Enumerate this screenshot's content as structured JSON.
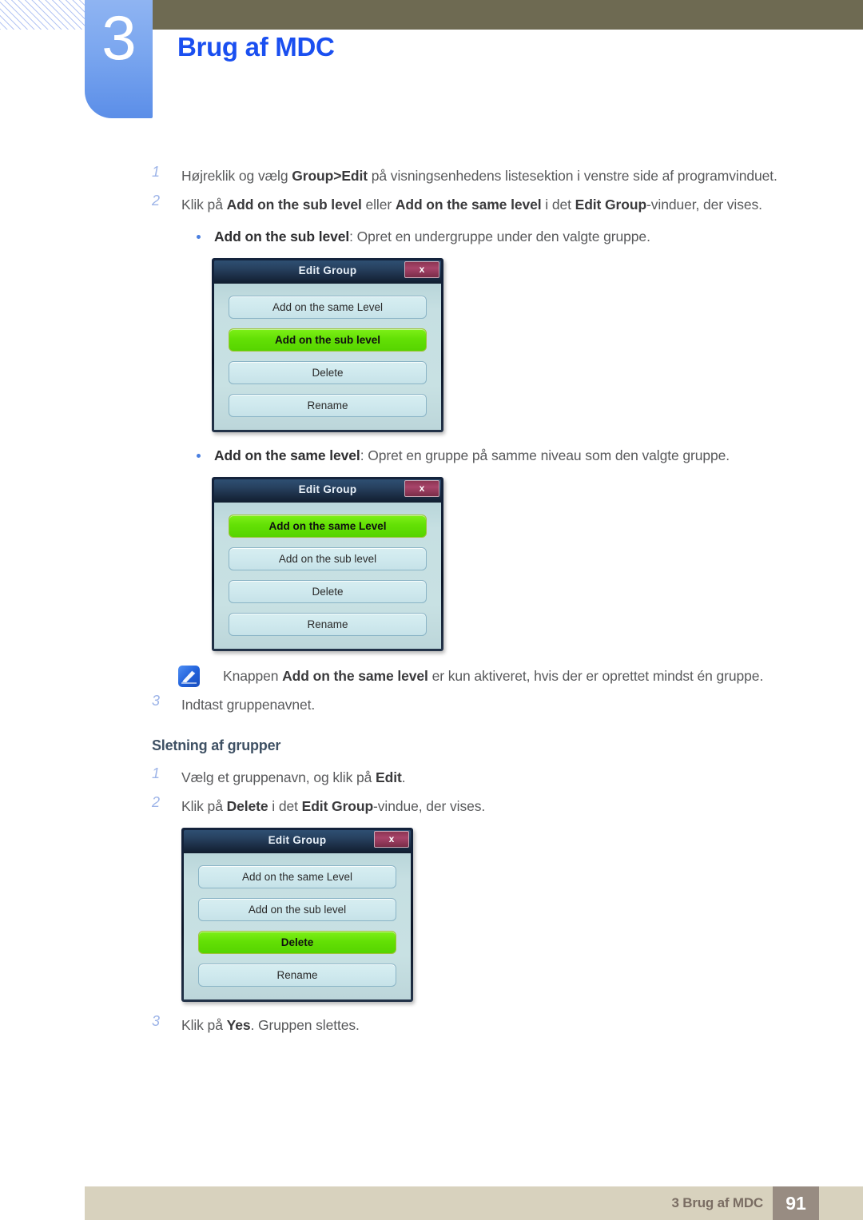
{
  "header": {
    "chapter_number": "3",
    "chapter_title": "Brug af MDC",
    "accent_color": "#1a4ff0",
    "tab_color": "#7aa6ef",
    "bar_color": "#6e6a52"
  },
  "steps": {
    "s1_num": "1",
    "s1_a": "Højreklik og vælg ",
    "s1_b": "Group>Edit",
    "s1_c": " på visningsenhedens listesektion i venstre side af programvinduet.",
    "s2_num": "2",
    "s2_a": "Klik på ",
    "s2_b": "Add on the sub level",
    "s2_c": " eller ",
    "s2_d": "Add on the same level",
    "s2_e": " i det ",
    "s2_f": "Edit Group",
    "s2_g": "-vinduer, der vises.",
    "b1_b": "Add on the sub level",
    "b1_c": ": Opret en undergruppe under den valgte gruppe.",
    "b2_b": "Add on the same level",
    "b2_c": ": Opret en gruppe på samme niveau som den valgte gruppe.",
    "note_a": "Knappen ",
    "note_b": "Add on the same level",
    "note_c": " er kun aktiveret, hvis der er oprettet mindst én gruppe.",
    "s3_num": "3",
    "s3_a": "Indtast gruppenavnet."
  },
  "section": {
    "heading": "Sletning af grupper",
    "d1_num": "1",
    "d1_a": "Vælg et gruppenavn, og klik på ",
    "d1_b": "Edit",
    "d1_c": ".",
    "d2_num": "2",
    "d2_a": "Klik på ",
    "d2_b": "Delete",
    "d2_c": " i det ",
    "d2_d": "Edit Group",
    "d2_e": "-vindue, der vises.",
    "d3_num": "3",
    "d3_a": "Klik på ",
    "d3_b": "Yes",
    "d3_c": ". Gruppen slettes."
  },
  "dialogs": [
    {
      "title": "Edit Group",
      "close_label": "x",
      "buttons": [
        {
          "label": "Add on the same Level",
          "active": false
        },
        {
          "label": "Add on the sub level",
          "active": true
        },
        {
          "label": "Delete",
          "active": false
        },
        {
          "label": "Rename",
          "active": false
        }
      ]
    },
    {
      "title": "Edit Group",
      "close_label": "x",
      "buttons": [
        {
          "label": "Add on the same Level",
          "active": true
        },
        {
          "label": "Add on the sub level",
          "active": false
        },
        {
          "label": "Delete",
          "active": false
        },
        {
          "label": "Rename",
          "active": false
        }
      ]
    },
    {
      "title": "Edit Group",
      "close_label": "x",
      "buttons": [
        {
          "label": "Add on the same Level",
          "active": false
        },
        {
          "label": "Add on the sub level",
          "active": false
        },
        {
          "label": "Delete",
          "active": true
        },
        {
          "label": "Rename",
          "active": false
        }
      ]
    }
  ],
  "footer": {
    "text": "3 Brug af MDC",
    "page": "91",
    "bar_color": "#d8d2be",
    "page_box_color": "#988c82"
  }
}
